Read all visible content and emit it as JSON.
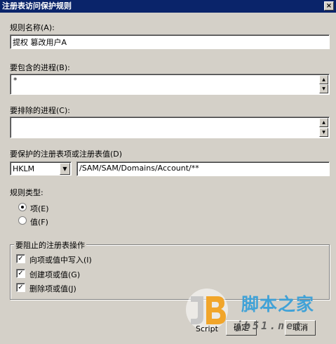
{
  "window": {
    "title": "注册表访问保护规则",
    "close_glyph": "×"
  },
  "rule_name": {
    "label": "规则名称(A):",
    "value": "提权 篡改用户A"
  },
  "include_process": {
    "label": "要包含的进程(B):",
    "value": "*"
  },
  "exclude_process": {
    "label": "要排除的进程(C):",
    "value": ""
  },
  "registry_target": {
    "label": "要保护的注册表项或注册表值(D)",
    "hive_selected": "HKLM",
    "path_value": "/SAM/SAM/Domains/Account/**"
  },
  "rule_type": {
    "label": "规则类型:",
    "options": [
      {
        "label": "项(E)",
        "selected": true
      },
      {
        "label": "值(F)",
        "selected": false
      }
    ]
  },
  "operations": {
    "title": "要阻止的注册表操作",
    "items": [
      {
        "label": "向项或值中写入(I)",
        "checked": true
      },
      {
        "label": "创建项或值(G)",
        "checked": true
      },
      {
        "label": "删除项或值(J)",
        "checked": true
      }
    ]
  },
  "footer": {
    "script_label": "Script",
    "ok_label": "确定",
    "cancel_label": "取消"
  },
  "watermark": {
    "site_name": "脚本之家",
    "url": "jb51.net"
  },
  "icons": {
    "scroll_up": "▲",
    "scroll_down": "▼",
    "dropdown": "▼",
    "check": "✓"
  }
}
